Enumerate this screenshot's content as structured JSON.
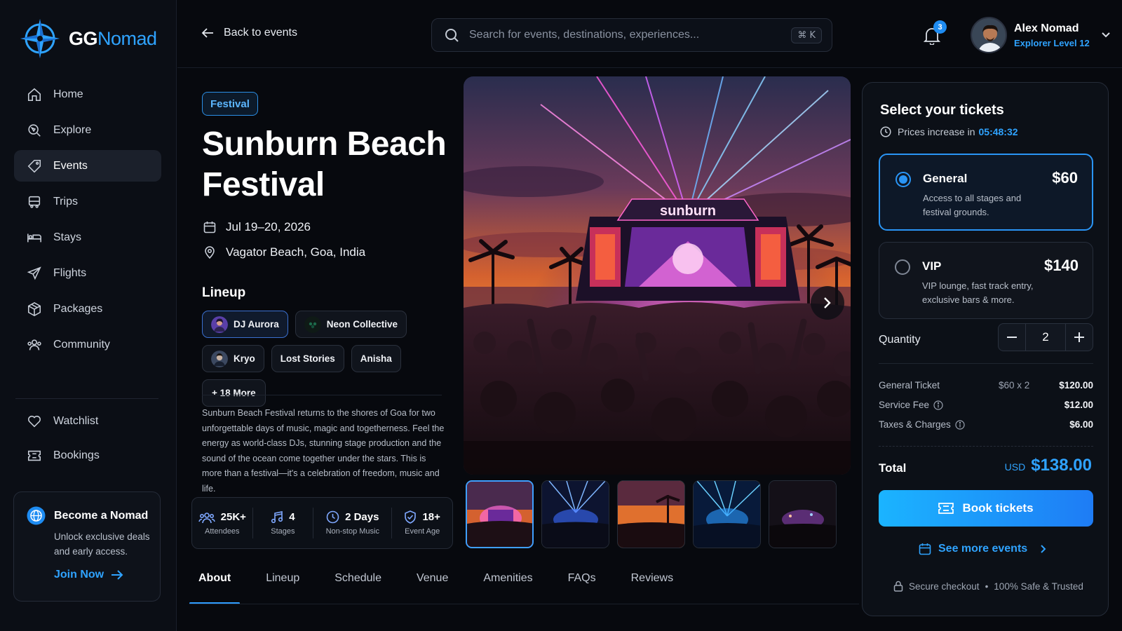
{
  "app": {
    "logo_primary": "GG",
    "logo_secondary": "Nomad"
  },
  "sidebar": {
    "items": [
      {
        "label": "Home",
        "icon": "home-icon"
      },
      {
        "label": "Explore",
        "icon": "search-icon"
      },
      {
        "label": "Events",
        "icon": "tag-icon",
        "active": true
      },
      {
        "label": "Trips",
        "icon": "bus-icon"
      },
      {
        "label": "Stays",
        "icon": "bed-icon"
      },
      {
        "label": "Flights",
        "icon": "plane-icon"
      },
      {
        "label": "Packages",
        "icon": "package-icon"
      },
      {
        "label": "Community",
        "icon": "users-icon"
      }
    ],
    "secondary": [
      {
        "label": "Watchlist",
        "icon": "heart-icon"
      },
      {
        "label": "Bookings",
        "icon": "ticket-icon"
      }
    ],
    "promo": {
      "title": "Become a Nomad",
      "text": "Unlock exclusive deals and early access.",
      "link": "Join Now"
    }
  },
  "topbar": {
    "back_label": "Back to events",
    "search_placeholder": "Search for events, destinations, experiences...",
    "search_shortcut": "⌘ K",
    "notifications_count": "3",
    "user_name": "Alex Nomad",
    "user_level": "Explorer Level 12"
  },
  "event": {
    "category": "Festival",
    "title": "Sunburn Beach Festival",
    "date": "Jul 19–20, 2026",
    "location": "Vagator Beach, Goa, India",
    "lineup_heading": "Lineup",
    "lineup": [
      "DJ Aurora",
      "Neon Collective",
      "Kryo",
      "Lost Stories",
      "Anisha",
      "+ 18 More"
    ],
    "description": "Sunburn Beach Festival returns to the shores of Goa for two unforgettable days of music, magic and togetherness. Feel the energy as world-class DJs, stunning stage production and the sound of the ocean come together under the stars. This is more than a festival—it's a celebration of freedom, music and life.",
    "stage_sign": "sunburn",
    "stats": [
      {
        "value": "25K+",
        "label": "Attendees",
        "icon": "users-icon"
      },
      {
        "value": "4",
        "label": "Stages",
        "icon": "music-icon"
      },
      {
        "value": "2 Days",
        "label": "Non-stop Music",
        "icon": "clock-icon"
      },
      {
        "value": "18+",
        "label": "Event Age",
        "icon": "shield-check-icon"
      }
    ]
  },
  "tabs": [
    "About",
    "Lineup",
    "Schedule",
    "Venue",
    "Amenities",
    "FAQs",
    "Reviews"
  ],
  "tickets": {
    "title": "Select your tickets",
    "countdown_label": "Prices increase in",
    "countdown": "05:48:32",
    "options": [
      {
        "name": "General",
        "price": "$60",
        "desc": "Access to all stages and festival grounds.",
        "selected": true
      },
      {
        "name": "VIP",
        "price": "$140",
        "desc": "VIP lounge, fast track entry, exclusive bars & more.",
        "selected": false
      }
    ],
    "quantity_label": "Quantity",
    "quantity": "2",
    "lines": [
      {
        "label": "General Ticket",
        "mid": "$60 x 2",
        "amount": "$120.00"
      },
      {
        "label": "Service Fee",
        "mid": "",
        "amount": "$12.00"
      },
      {
        "label": "Taxes & Charges",
        "mid": "",
        "amount": "$6.00"
      }
    ],
    "total_label": "Total",
    "total_currency": "USD",
    "total": "$138.00",
    "book_label": "Book tickets",
    "more_label": "See more events",
    "secure_label": "Secure checkout",
    "trust_label": "100% Safe & Trusted"
  },
  "colors": {
    "accent": "#2fa3ff",
    "bg": "#07090e",
    "panel": "#0c1017"
  }
}
